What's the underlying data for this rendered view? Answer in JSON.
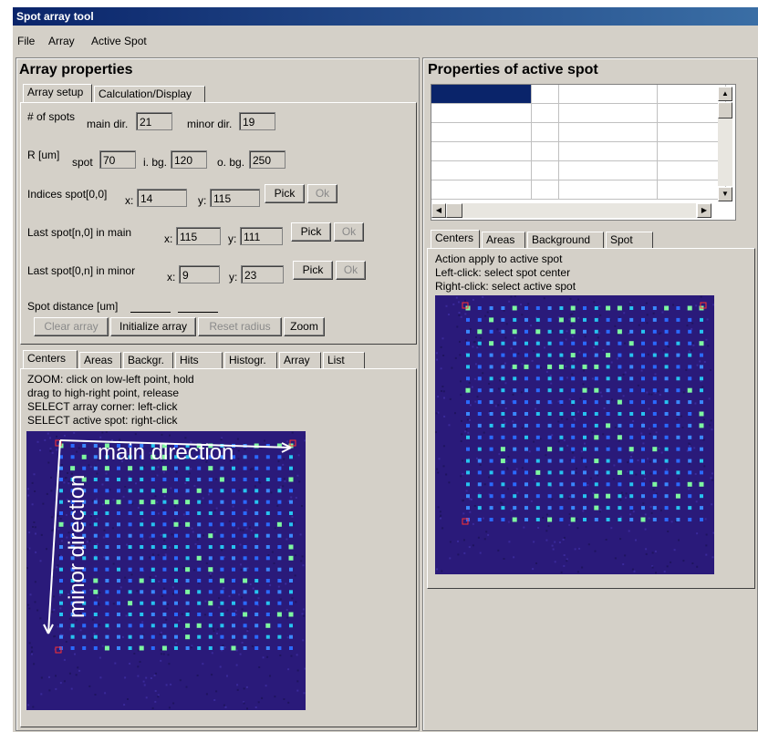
{
  "window": {
    "title": "Spot array tool"
  },
  "menu": [
    "File",
    "Array",
    "Active Spot"
  ],
  "left": {
    "title": "Array properties",
    "tabs": [
      "Array setup",
      "Calculation/Display"
    ],
    "num_spots": {
      "label": "# of spots",
      "main_label": "main dir.",
      "main_value": "21",
      "minor_label": "minor dir.",
      "minor_value": "19"
    },
    "radius": {
      "label": "R [um]",
      "spot_label": "spot",
      "spot_value": "70",
      "ibg_label": "i. bg.",
      "ibg_value": "120",
      "obg_label": "o. bg.",
      "obg_value": "250"
    },
    "indices": {
      "label": "Indices spot[0,0]",
      "x_label": "x:",
      "x_value": "14",
      "y_label": "y:",
      "y_value": "115"
    },
    "last_main": {
      "label": "Last spot[n,0] in main",
      "x_label": "x:",
      "x_value": "115",
      "y_label": "y:",
      "y_value": "111"
    },
    "last_minor": {
      "label": "Last spot[0,n] in minor",
      "x_label": "x:",
      "x_value": "9",
      "y_label": "y:",
      "y_value": "23"
    },
    "pick_label": "Pick",
    "ok_label": "Ok",
    "spot_distance_label": "Spot distance [um]",
    "buttons": {
      "clear": "Clear array",
      "init": "Initialize array",
      "reset": "Reset radius",
      "zoom": "Zoom"
    },
    "view_tabs": [
      "Centers",
      "Areas",
      "Backgr.",
      "Hits",
      "Histogr.",
      "Array",
      "List"
    ],
    "instructions": [
      "ZOOM: click on low-left point, hold",
      "drag to high-right point, release",
      "SELECT array corner: left-click",
      "SELECT active spot: right-click"
    ],
    "overlay": {
      "main": "main direction",
      "minor": "minor direction"
    }
  },
  "right": {
    "title": "Properties of active spot",
    "tabs": [
      "Centers",
      "Areas",
      "Background",
      "Spot"
    ],
    "instructions": [
      "Action apply to active spot",
      "Left-click: select spot center",
      "Right-click: select active spot"
    ]
  },
  "colors": {
    "title_start": "#0a246a",
    "title_end": "#3a6ea5",
    "panel": "#d4d0c8",
    "image_bg": "#2a1a7a",
    "grid_selected": "#0a246a"
  }
}
